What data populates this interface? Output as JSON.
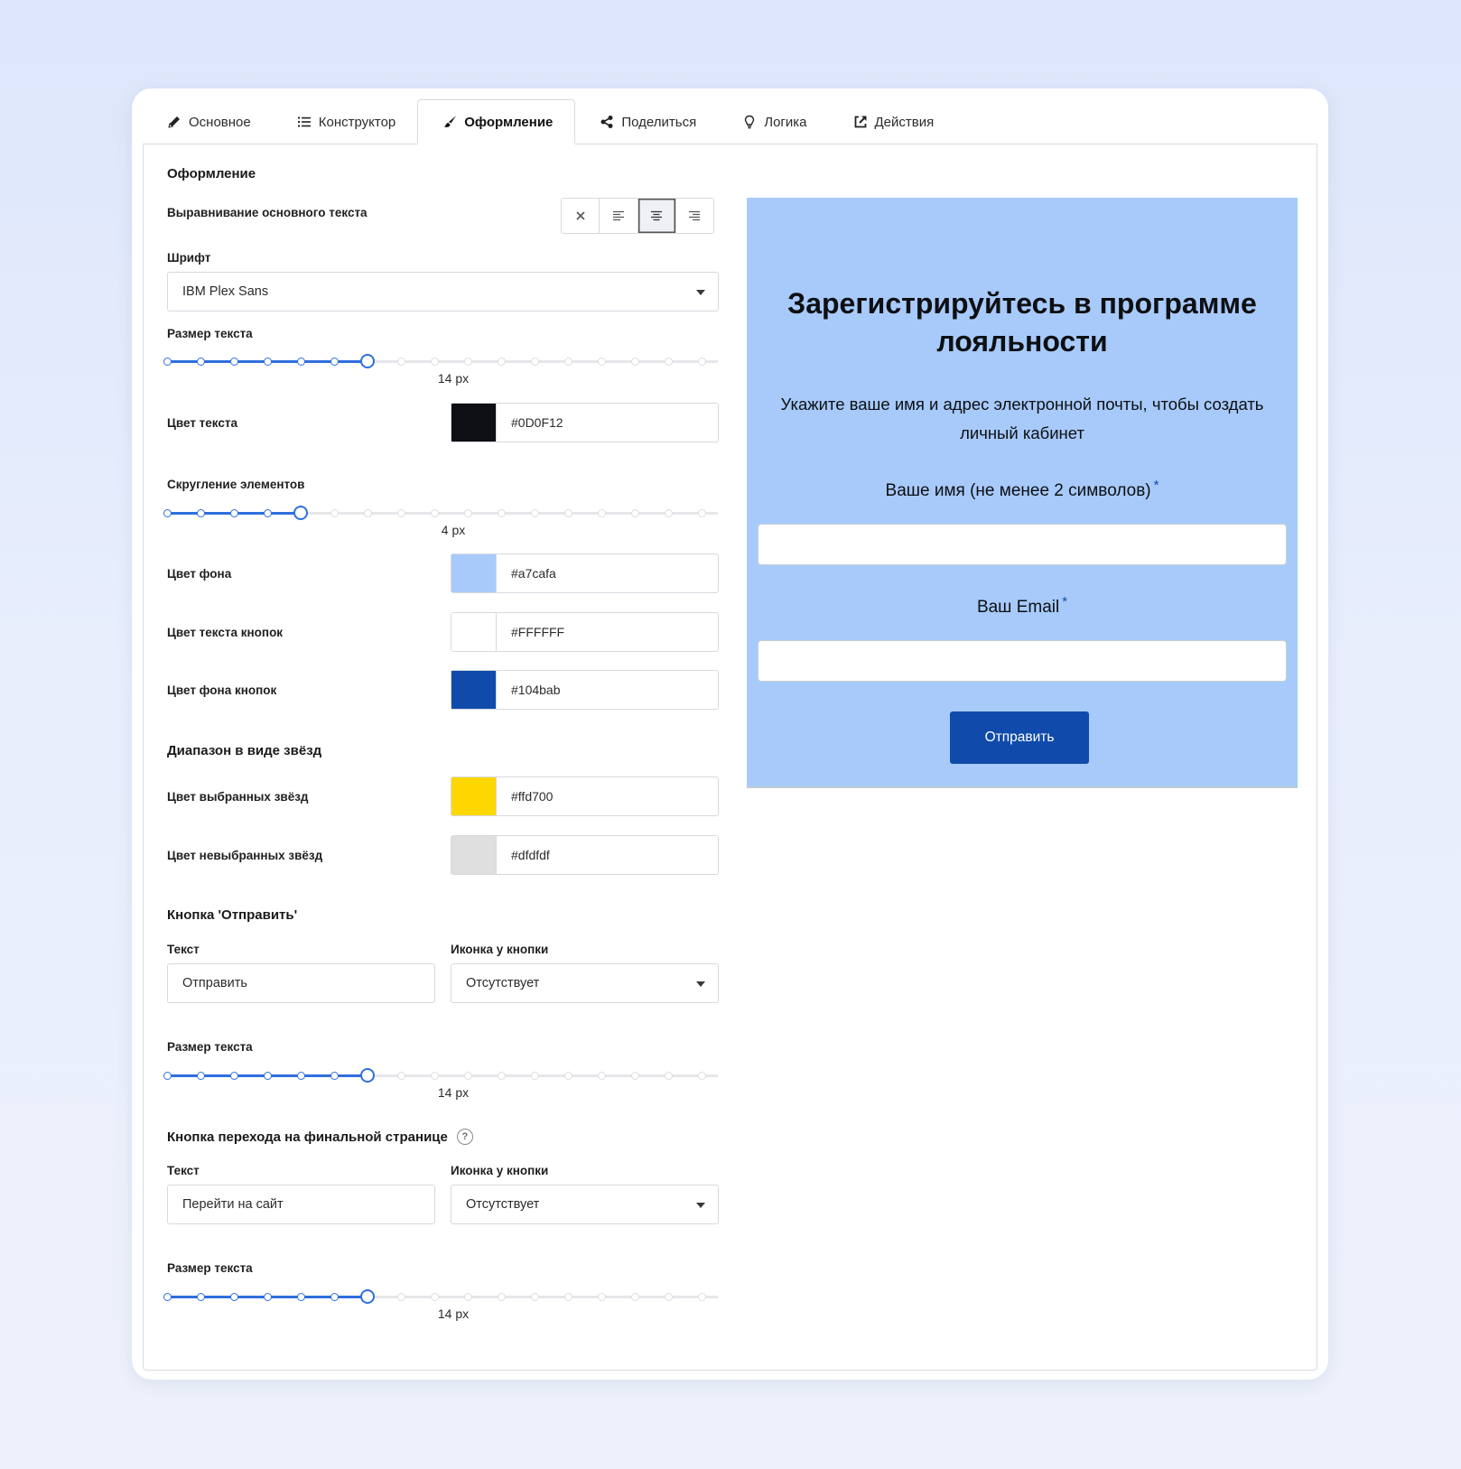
{
  "tabs": [
    {
      "label": "Основное",
      "icon": "pencil-icon"
    },
    {
      "label": "Конструктор",
      "icon": "list-icon"
    },
    {
      "label": "Оформление",
      "icon": "brush-icon",
      "active": true
    },
    {
      "label": "Поделиться",
      "icon": "share-icon"
    },
    {
      "label": "Логика",
      "icon": "lightbulb-icon"
    },
    {
      "label": "Действия",
      "icon": "external-link-icon"
    }
  ],
  "settings": {
    "section_title": "Оформление",
    "alignment_label": "Выравнивание основного текста",
    "alignment_selected": "center",
    "font_label": "Шрифт",
    "font_value": "IBM Plex Sans",
    "text_size_label": "Размер текста",
    "text_size_value": "14 px",
    "text_color_label": "Цвет текста",
    "text_color": "#0D0F12",
    "rounding_label": "Скругление элементов",
    "rounding_value": "4 px",
    "bg_color_label": "Цвет фона",
    "bg_color": "#a7cafa",
    "btn_text_color_label": "Цвет текста кнопок",
    "btn_text_color": "#FFFFFF",
    "btn_bg_color_label": "Цвет фона кнопок",
    "btn_bg_color": "#104bab",
    "stars_section_title": "Диапазон в виде звёзд",
    "stars_selected_label": "Цвет выбранных звёзд",
    "stars_selected_color": "#ffd700",
    "stars_unselected_label": "Цвет невыбранных звёзд",
    "stars_unselected_color": "#dfdfdf",
    "submit_section_title": "Кнопка 'Отправить'",
    "submit_text_label": "Текст",
    "submit_text_value": "Отправить",
    "submit_icon_label": "Иконка у кнопки",
    "submit_icon_value": "Отсутствует",
    "submit_size_label": "Размер текста",
    "submit_size_value": "14 px",
    "final_section_title": "Кнопка перехода на финальной странице",
    "final_text_label": "Текст",
    "final_text_value": "Перейти на сайт",
    "final_icon_label": "Иконка у кнопки",
    "final_icon_value": "Отсутствует",
    "final_size_label": "Размер текста",
    "final_size_value": "14 px"
  },
  "sliders": {
    "text_size": {
      "steps": 17,
      "selected_index": 6
    },
    "rounding": {
      "steps": 17,
      "selected_index": 4
    },
    "submit_size": {
      "steps": 17,
      "selected_index": 6
    },
    "final_size": {
      "steps": 17,
      "selected_index": 6
    }
  },
  "preview": {
    "title": "Зарегистрируйтесь в программе лояльности",
    "subtitle": "Укажите ваше имя и адрес электронной почты, чтобы создать личный кабинет",
    "name_label": "Ваше имя (не менее 2 символов)",
    "email_label": "Ваш Email",
    "required_mark": "*",
    "submit_label": "Отправить"
  },
  "colors": {
    "accent": "#2f6fde",
    "preview_bg": "#a7cafa",
    "button_bg": "#104bab"
  }
}
